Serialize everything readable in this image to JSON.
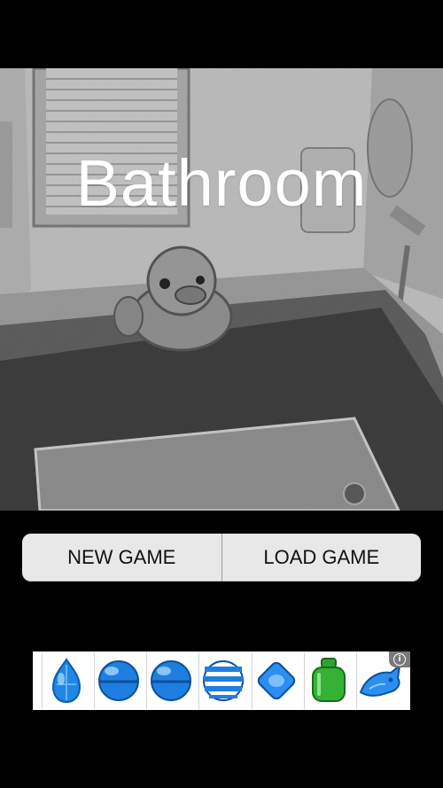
{
  "scene": {
    "title": "Bathroom"
  },
  "menu": {
    "new_game_label": "NEW GAME",
    "load_game_label": "LOAD GAME"
  },
  "ad_banner": {
    "info_icon": "info-icon",
    "items": [
      {
        "icon": "blue-gem-drop-icon"
      },
      {
        "icon": "blue-sphere-candy-icon"
      },
      {
        "icon": "blue-sphere-candy-icon"
      },
      {
        "icon": "blue-striped-candy-icon"
      },
      {
        "icon": "blue-diamond-candy-icon"
      },
      {
        "icon": "green-jar-candy-icon"
      },
      {
        "icon": "blue-fish-candy-icon"
      }
    ],
    "info_glyph": "i"
  },
  "colors": {
    "background": "#000000",
    "button_fill": "#e8e8e8",
    "title_text": "#ffffff",
    "candy_blue": "#1f7fe0",
    "candy_green": "#2ea52e"
  }
}
